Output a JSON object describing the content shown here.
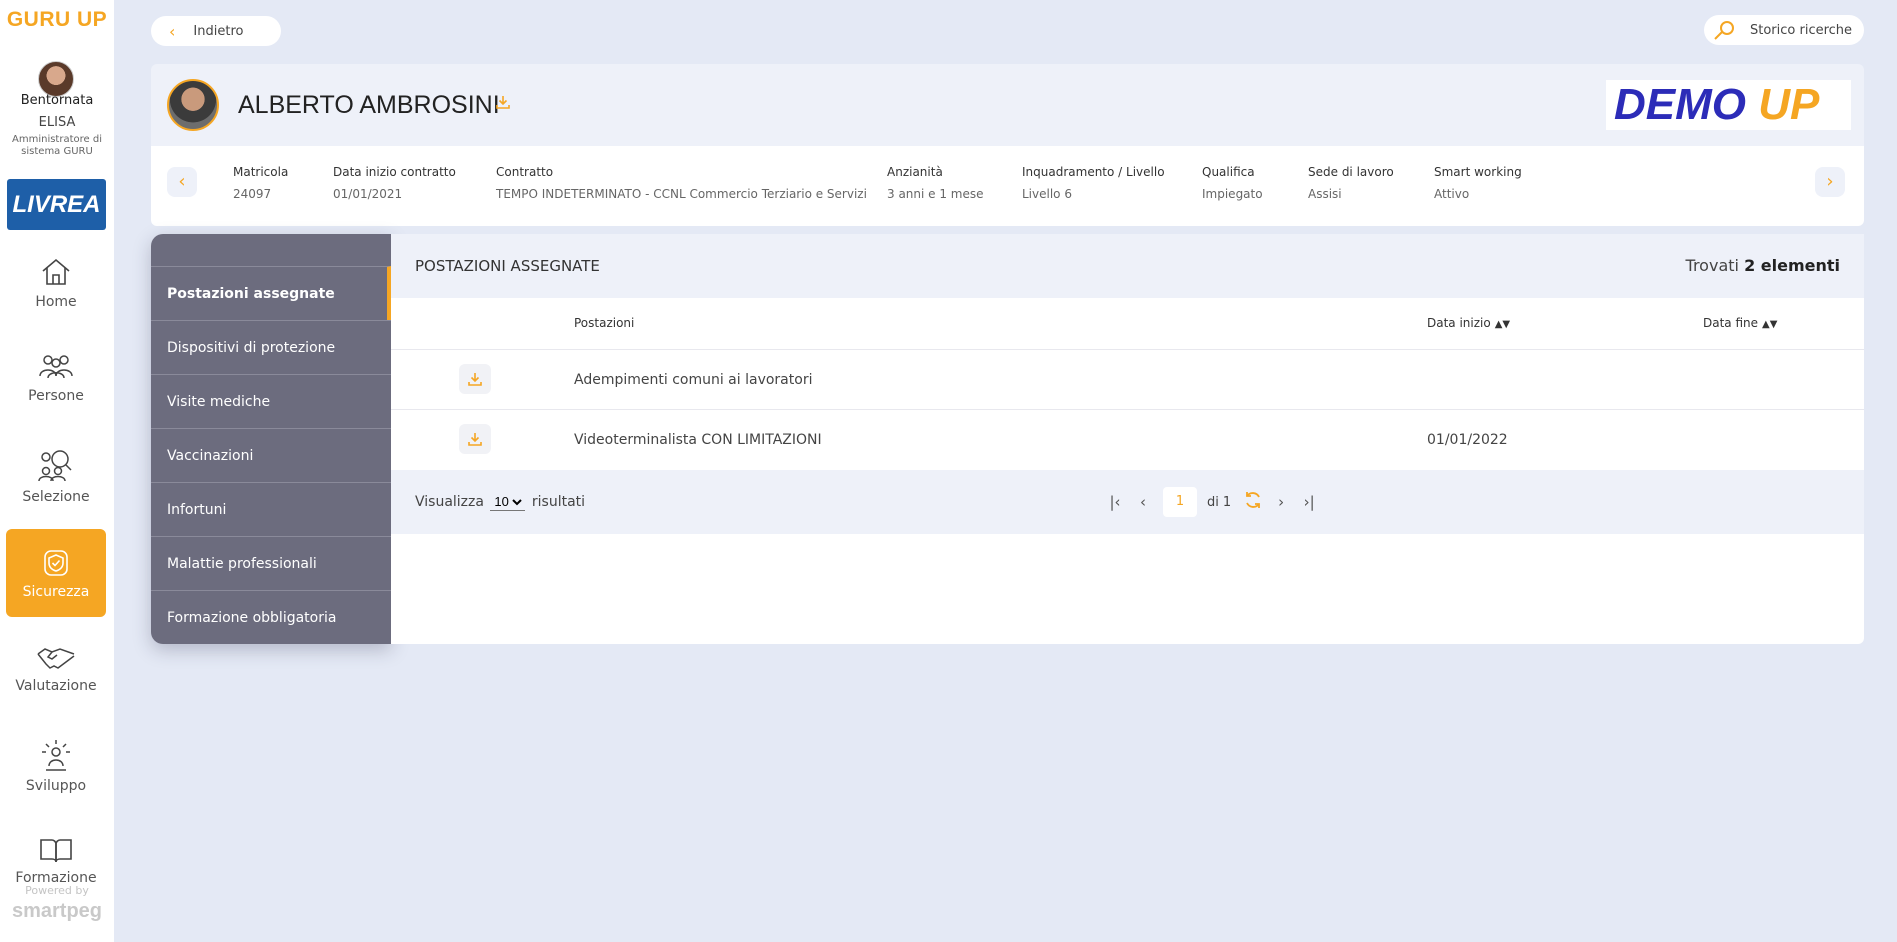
{
  "sidebar": {
    "brand": "GURU UP",
    "welcome": "Bentornata",
    "user_name": "ELISA",
    "user_role": "Amministratore di sistema GURU",
    "company": "LIVREA",
    "nav": [
      {
        "label": "Home",
        "icon": "home-icon"
      },
      {
        "label": "Persone",
        "icon": "people-icon"
      },
      {
        "label": "Selezione",
        "icon": "people-search-icon"
      },
      {
        "label": "Sicurezza",
        "icon": "shield-check-icon",
        "active": true
      },
      {
        "label": "Valutazione",
        "icon": "handshake-icon"
      },
      {
        "label": "Sviluppo",
        "icon": "growth-icon"
      },
      {
        "label": "Formazione",
        "icon": "book-icon"
      }
    ],
    "powered_by": "Powered by",
    "powered_brand": "smartpeg"
  },
  "topbar": {
    "back_label": "Indietro",
    "history_label": "Storico ricerche"
  },
  "employee": {
    "name": "ALBERTO AMBROSINI",
    "org_logo": "DEMO UP",
    "fields": [
      {
        "key": "Matricola",
        "value": "24097"
      },
      {
        "key": "Data inizio contratto",
        "value": "01/01/2021"
      },
      {
        "key": "Contratto",
        "value": "TEMPO INDETERMINATO - CCNL Commercio Terziario e Servizi"
      },
      {
        "key": "Anzianità",
        "value": "3 anni e 1 mese"
      },
      {
        "key": "Inquadramento / Livello",
        "value": "Livello 6"
      },
      {
        "key": "Qualifica",
        "value": "Impiegato"
      },
      {
        "key": "Sede di lavoro",
        "value": "Assisi"
      },
      {
        "key": "Smart working",
        "value": "Attivo"
      }
    ]
  },
  "tabs": [
    {
      "label": "Postazioni assegnate",
      "active": true
    },
    {
      "label": "Dispositivi di protezione"
    },
    {
      "label": "Visite mediche"
    },
    {
      "label": "Vaccinazioni"
    },
    {
      "label": "Infortuni"
    },
    {
      "label": "Malattie professionali"
    },
    {
      "label": "Formazione obbligatoria"
    }
  ],
  "content": {
    "title": "POSTAZIONI ASSEGNATE",
    "found_prefix": "Trovati",
    "found_count": "2 elementi",
    "columns": {
      "postazioni": "Postazioni",
      "data_inizio": "Data inizio",
      "data_fine": "Data fine"
    },
    "rows": [
      {
        "postazione": "Adempimenti comuni ai lavoratori",
        "data_inizio": "",
        "data_fine": ""
      },
      {
        "postazione": "Videoterminalista CON LIMITAZIONI",
        "data_inizio": "01/01/2022",
        "data_fine": ""
      }
    ]
  },
  "pager": {
    "show_label": "Visualizza",
    "page_size": "10",
    "results_label": "risultati",
    "current_page": "1",
    "of_label": "di",
    "total_pages": "1"
  },
  "colors": {
    "accent": "#f5a623",
    "tabs_bg": "#6c6c7e",
    "page_bg": "#e4e9f5"
  }
}
